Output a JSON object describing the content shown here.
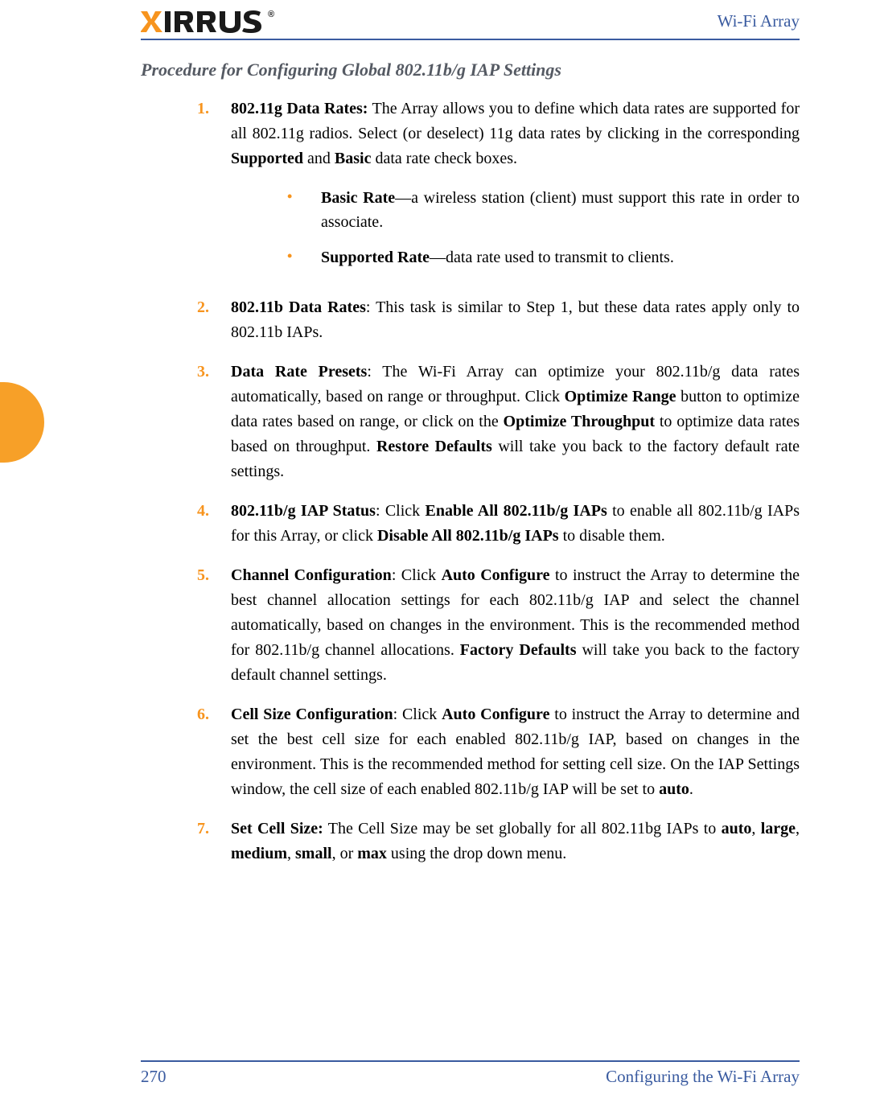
{
  "header": {
    "logo_text": "IRRUS",
    "logo_x": "X",
    "reg": "®",
    "right": "Wi-Fi Array"
  },
  "title": "Procedure for Configuring Global 802.11b/g IAP Settings",
  "steps": {
    "s1": {
      "num": "1.",
      "lead": "802.11g Data Rates:",
      "text_a": " The Array allows you to define which data rates are supported for all 802.11g radios. Select (or deselect) 11g data rates by clicking in the corresponding ",
      "b1": "Supported",
      "mid": " and ",
      "b2": "Basic",
      "text_b": " data rate check boxes."
    },
    "sub_a": {
      "bullet": "•",
      "lead": "Basic Rate",
      "text": "—a wireless station (client) must support this rate in order to associate."
    },
    "sub_b": {
      "bullet": "•",
      "lead": "Supported Rate",
      "text": "—data rate used to transmit to clients."
    },
    "s2": {
      "num": "2.",
      "lead": "802.11b Data Rates",
      "text": ": This task is similar to Step 1, but these data rates apply only to 802.11b IAPs."
    },
    "s3": {
      "num": "3.",
      "lead": "Data Rate Presets",
      "text_a": ": The Wi-Fi Array can optimize your 802.11b/g data rates automatically, based on range or throughput. Click ",
      "b1": "Optimize Range",
      "text_b": " button to optimize data rates based on range, or click on the ",
      "b2": "Optimize Throughput",
      "text_c": " to optimize data rates based on throughput. ",
      "b3": "Restore Defaults",
      "text_d": " will take you back to the factory default rate settings."
    },
    "s4": {
      "num": "4.",
      "lead": "802.11b/g IAP Status",
      "text_a": ": Click ",
      "b1": "Enable All 802.11b/g IAPs",
      "text_b": " to enable all 802.11b/g IAPs for this Array, or click ",
      "b2": "Disable All 802.11b/g IAPs",
      "text_c": " to disable them."
    },
    "s5": {
      "num": "5.",
      "lead": "Channel Configuration",
      "text_a": ": Click ",
      "b1": "Auto Configure",
      "text_b": " to instruct the Array to determine the best channel allocation settings for each 802.11b/g IAP and select the channel automatically, based on changes in the environment. This is the recommended method for 802.11b/g channel allocations. ",
      "b2": "Factory Defaults",
      "text_c": " will take you back to the factory default channel settings."
    },
    "s6": {
      "num": "6.",
      "lead": "Cell Size Configuration",
      "text_a": ": Click ",
      "b1": "Auto Configure",
      "text_b": " to instruct the Array to determine and set the best cell size for each enabled 802.11b/g IAP, based on changes in the environment. This is the recommended method for setting cell size. On the IAP Settings window, the cell size of each enabled 802.11b/g IAP will be set to ",
      "b2": "auto",
      "text_c": "."
    },
    "s7": {
      "num": "7.",
      "lead": "Set Cell Size:",
      "text_a": " The Cell Size may be set globally for all 802.11bg IAPs to ",
      "b1": "auto",
      "c1": ", ",
      "b2": "large",
      "c2": ", ",
      "b3": "medium",
      "c3": ", ",
      "b4": "small",
      "c4": ", or ",
      "b5": "max",
      "text_b": " using the drop down menu."
    }
  },
  "footer": {
    "page": "270",
    "right": "Configuring the Wi-Fi Array"
  }
}
